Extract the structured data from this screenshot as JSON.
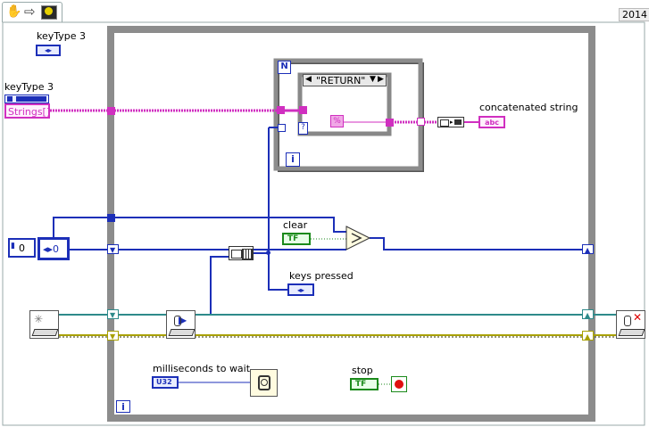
{
  "toolbar": {
    "run_icon": "hand-icon",
    "arrow_icon": "arrow-right-icon",
    "highlight_icon": "lightbulb-icon",
    "version": "2014"
  },
  "controls": {
    "keytype_typedef_label": "keyType 3",
    "keytype_array_label": "keyType 3",
    "keytype_array_text": "Strings[]",
    "numeric_index": "0",
    "numeric_value": "0",
    "enum_terminal_text": "◂▸"
  },
  "case_structure": {
    "selector_value": "\"RETURN\"",
    "for_loop_count": "N",
    "for_loop_index": "i",
    "selector_question": "?"
  },
  "indicators": {
    "concatenated_string": "concatenated string",
    "concatenated_terminal": "abc",
    "clear": "clear",
    "clear_terminal": "TF",
    "keys_pressed": "keys pressed",
    "keys_pressed_terminal": "◂▸",
    "milliseconds_to_wait": "milliseconds to wait",
    "ms_terminal": "U32",
    "stop": "stop",
    "stop_terminal": "TF"
  },
  "while_loop": {
    "iteration": "i"
  },
  "colors": {
    "frame_gray": "#8c8c8c",
    "wire_blue": "#1c2fb8",
    "wire_pink": "#d02fc0",
    "wire_green": "#1b8a1b",
    "wire_teal": "#2e8a8a",
    "wire_yellow": "#a8a000"
  }
}
